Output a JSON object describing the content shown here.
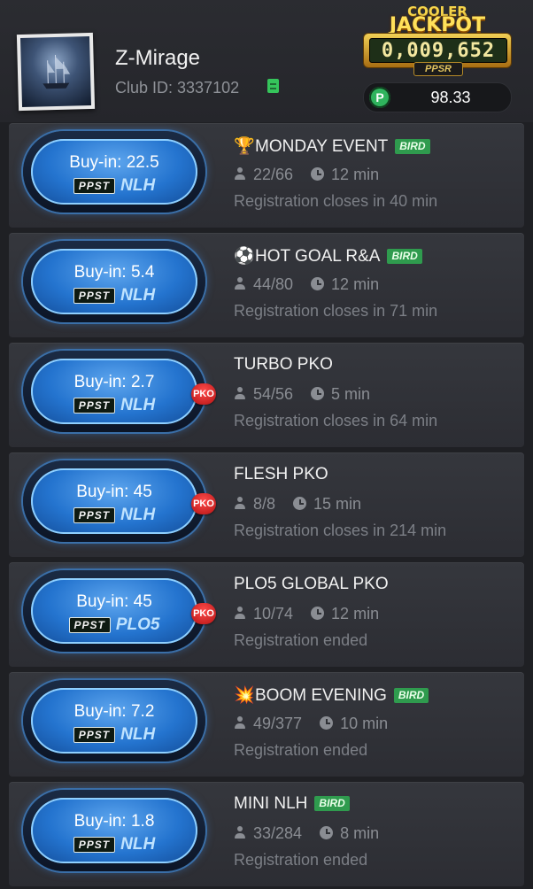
{
  "header": {
    "player_name": "Z-Mirage",
    "club_id": "Club ID: 3337102",
    "jackpot": {
      "top": "COOLER",
      "title": "JACKPOT",
      "value": "0,009,652",
      "brand": "PPSR"
    },
    "balance": {
      "icon_letter": "P",
      "value": "98.33"
    }
  },
  "tournaments": [
    {
      "buy_in": "Buy-in: 22.5",
      "brand": "PPST",
      "game": "NLH",
      "pko": false,
      "emoji": "🏆",
      "title": "MONDAY EVENT",
      "bird": true,
      "players": "22/66",
      "duration": "12 min",
      "status": "Registration closes in 40 min"
    },
    {
      "buy_in": "Buy-in: 5.4",
      "brand": "PPST",
      "game": "NLH",
      "pko": false,
      "emoji": "⚽",
      "title": "HOT GOAL R&A",
      "bird": true,
      "players": "44/80",
      "duration": "12 min",
      "status": "Registration closes in 71 min"
    },
    {
      "buy_in": "Buy-in: 2.7",
      "brand": "PPST",
      "game": "NLH",
      "pko": true,
      "emoji": "",
      "title": "TURBO PKO",
      "bird": false,
      "players": "54/56",
      "duration": "5 min",
      "status": "Registration closes in 64 min"
    },
    {
      "buy_in": "Buy-in: 45",
      "brand": "PPST",
      "game": "NLH",
      "pko": true,
      "emoji": "",
      "title": "FLESH PKO",
      "bird": false,
      "players": "8/8",
      "duration": "15 min",
      "status": "Registration closes in 214 min"
    },
    {
      "buy_in": "Buy-in: 45",
      "brand": "PPST",
      "game": "PLO5",
      "pko": true,
      "emoji": "",
      "title": "PLO5 GLOBAL PKO",
      "bird": false,
      "players": "10/74",
      "duration": "12 min",
      "status": "Registration ended"
    },
    {
      "buy_in": "Buy-in: 7.2",
      "brand": "PPST",
      "game": "NLH",
      "pko": false,
      "emoji": "💥",
      "title": "BOOM EVENING",
      "bird": true,
      "players": "49/377",
      "duration": "10 min",
      "status": "Registration ended"
    },
    {
      "buy_in": "Buy-in: 1.8",
      "brand": "PPST",
      "game": "NLH",
      "pko": false,
      "emoji": "",
      "title": "MINI NLH",
      "bird": true,
      "players": "33/284",
      "duration": "8 min",
      "status": "Registration ended"
    }
  ],
  "labels": {
    "pko": "PKO",
    "bird": "BIRD"
  }
}
